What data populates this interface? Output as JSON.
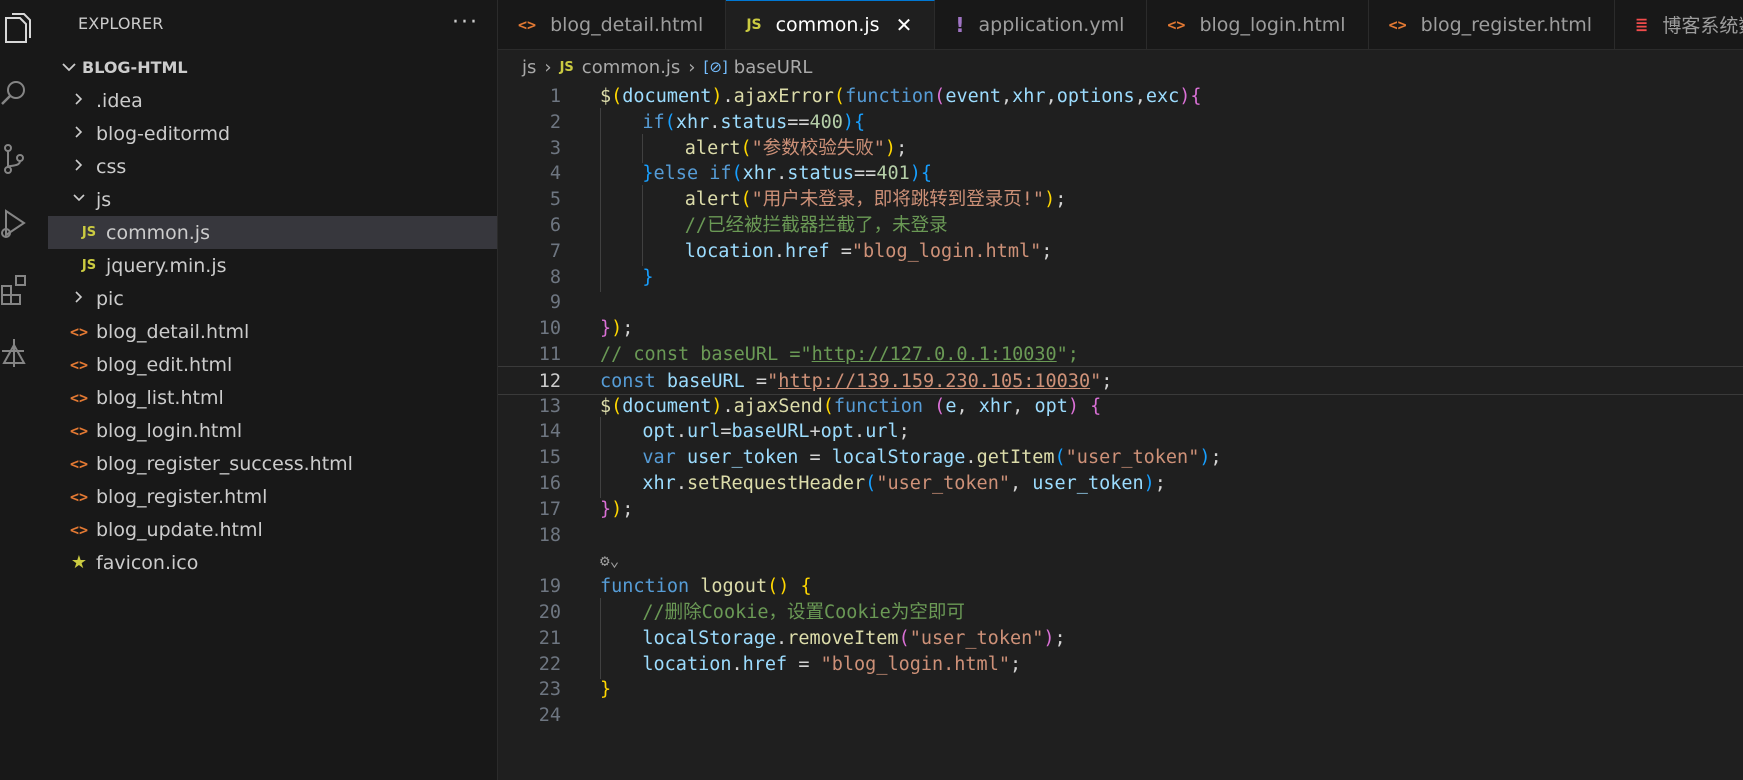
{
  "sidebar": {
    "title": "EXPLORER",
    "more": "···",
    "root": "BLOG-HTML",
    "items": [
      {
        "label": ".idea",
        "kind": "folder",
        "state": "collapsed",
        "indent": 1
      },
      {
        "label": "blog-editormd",
        "kind": "folder",
        "state": "collapsed",
        "indent": 1
      },
      {
        "label": "css",
        "kind": "folder",
        "state": "collapsed",
        "indent": 1
      },
      {
        "label": "js",
        "kind": "folder",
        "state": "expanded",
        "indent": 1
      },
      {
        "label": "common.js",
        "kind": "js",
        "indent": 2,
        "selected": true
      },
      {
        "label": "jquery.min.js",
        "kind": "js",
        "indent": 2
      },
      {
        "label": "pic",
        "kind": "folder",
        "state": "collapsed",
        "indent": 1
      },
      {
        "label": "blog_detail.html",
        "kind": "html",
        "indent": 1
      },
      {
        "label": "blog_edit.html",
        "kind": "html",
        "indent": 1
      },
      {
        "label": "blog_list.html",
        "kind": "html",
        "indent": 1
      },
      {
        "label": "blog_login.html",
        "kind": "html",
        "indent": 1
      },
      {
        "label": "blog_register_success.html",
        "kind": "html",
        "indent": 1
      },
      {
        "label": "blog_register.html",
        "kind": "html",
        "indent": 1
      },
      {
        "label": "blog_update.html",
        "kind": "html",
        "indent": 1
      },
      {
        "label": "favicon.ico",
        "kind": "star",
        "indent": 1
      }
    ]
  },
  "tabs": [
    {
      "label": "blog_detail.html",
      "kind": "html"
    },
    {
      "label": "common.js",
      "kind": "js",
      "active": true,
      "close": "✕"
    },
    {
      "label": "application.yml",
      "kind": "yml"
    },
    {
      "label": "blog_login.html",
      "kind": "html"
    },
    {
      "label": "blog_register.html",
      "kind": "html"
    },
    {
      "label": "博客系统数",
      "kind": "db"
    }
  ],
  "breadcrumb": {
    "folder": "js",
    "file": "common.js",
    "symbol": "baseURL"
  },
  "editor": {
    "current_line": 12,
    "lines": [
      {
        "n": 1,
        "indent": 0,
        "t": [
          [
            "$",
            "f"
          ],
          [
            "(",
            "b1"
          ],
          [
            "document",
            "v"
          ],
          [
            ")",
            "b1"
          ],
          [
            ".",
            "p"
          ],
          [
            "ajaxError",
            "f"
          ],
          [
            "(",
            "b1"
          ],
          [
            "function",
            "k"
          ],
          [
            "(",
            "b2"
          ],
          [
            "event",
            "v"
          ],
          [
            ",",
            "p"
          ],
          [
            "xhr",
            "v"
          ],
          [
            ",",
            "p"
          ],
          [
            "options",
            "v"
          ],
          [
            ",",
            "p"
          ],
          [
            "exc",
            "v"
          ],
          [
            ")",
            "b2"
          ],
          [
            "{",
            "b2"
          ]
        ]
      },
      {
        "n": 2,
        "indent": 1,
        "t": [
          [
            "if",
            "k"
          ],
          [
            "(",
            "b3"
          ],
          [
            "xhr",
            "v"
          ],
          [
            ".",
            "p"
          ],
          [
            "status",
            "v"
          ],
          [
            "==",
            "p"
          ],
          [
            "400",
            "n"
          ],
          [
            ")",
            "b3"
          ],
          [
            "{",
            "b3"
          ]
        ]
      },
      {
        "n": 3,
        "indent": 2,
        "t": [
          [
            "alert",
            "f"
          ],
          [
            "(",
            "b1"
          ],
          [
            "\"参数校验失败\"",
            "s"
          ],
          [
            ")",
            "b1"
          ],
          [
            ";",
            "p"
          ]
        ]
      },
      {
        "n": 4,
        "indent": 1,
        "t": [
          [
            "}",
            "b3"
          ],
          [
            "else ",
            "k"
          ],
          [
            "if",
            "k"
          ],
          [
            "(",
            "b3"
          ],
          [
            "xhr",
            "v"
          ],
          [
            ".",
            "p"
          ],
          [
            "status",
            "v"
          ],
          [
            "==",
            "p"
          ],
          [
            "401",
            "n"
          ],
          [
            ")",
            "b3"
          ],
          [
            "{",
            "b3"
          ]
        ]
      },
      {
        "n": 5,
        "indent": 2,
        "t": [
          [
            "alert",
            "f"
          ],
          [
            "(",
            "b1"
          ],
          [
            "\"用户未登录，即将跳转到登录页!\"",
            "s"
          ],
          [
            ")",
            "b1"
          ],
          [
            ";",
            "p"
          ]
        ]
      },
      {
        "n": 6,
        "indent": 2,
        "t": [
          [
            "//已经被拦截器拦截了，未登录",
            "c"
          ]
        ]
      },
      {
        "n": 7,
        "indent": 2,
        "t": [
          [
            "location",
            "v"
          ],
          [
            ".",
            "p"
          ],
          [
            "href",
            "v"
          ],
          [
            " =",
            "p"
          ],
          [
            "\"blog_login.html\"",
            "s"
          ],
          [
            ";",
            "p"
          ]
        ]
      },
      {
        "n": 8,
        "indent": 1,
        "t": [
          [
            "}",
            "b3"
          ]
        ]
      },
      {
        "n": 9,
        "indent": 0,
        "t": []
      },
      {
        "n": 10,
        "indent": 0,
        "t": [
          [
            "}",
            "b2"
          ],
          [
            ")",
            "b1"
          ],
          [
            ";",
            "p"
          ]
        ]
      },
      {
        "n": 11,
        "indent": 0,
        "t": [
          [
            "// const baseURL =\"",
            "c"
          ],
          [
            "http://127.0.0.1:10030",
            "cu"
          ],
          [
            "\";",
            "c"
          ]
        ]
      },
      {
        "n": 12,
        "indent": 0,
        "t": [
          [
            "const ",
            "k"
          ],
          [
            "baseURL",
            "v"
          ],
          [
            " =",
            "p"
          ],
          [
            "\"",
            "s"
          ],
          [
            "http://139.159.230.105:10030",
            "su"
          ],
          [
            "\"",
            "s"
          ],
          [
            ";",
            "p"
          ]
        ]
      },
      {
        "n": 13,
        "indent": 0,
        "t": [
          [
            "$",
            "f"
          ],
          [
            "(",
            "b1"
          ],
          [
            "document",
            "v"
          ],
          [
            ")",
            "b1"
          ],
          [
            ".",
            "p"
          ],
          [
            "ajaxSend",
            "f"
          ],
          [
            "(",
            "b1"
          ],
          [
            "function ",
            "k"
          ],
          [
            "(",
            "b2"
          ],
          [
            "e",
            "v"
          ],
          [
            ", ",
            "p"
          ],
          [
            "xhr",
            "v"
          ],
          [
            ", ",
            "p"
          ],
          [
            "opt",
            "v"
          ],
          [
            ")",
            "b2"
          ],
          [
            " ",
            "p"
          ],
          [
            "{",
            "b2"
          ]
        ]
      },
      {
        "n": 14,
        "indent": 1,
        "t": [
          [
            "opt",
            "v"
          ],
          [
            ".",
            "p"
          ],
          [
            "url",
            "v"
          ],
          [
            "=",
            "p"
          ],
          [
            "baseURL",
            "v"
          ],
          [
            "+",
            "p"
          ],
          [
            "opt",
            "v"
          ],
          [
            ".",
            "p"
          ],
          [
            "url",
            "v"
          ],
          [
            ";",
            "p"
          ]
        ]
      },
      {
        "n": 15,
        "indent": 1,
        "t": [
          [
            "var ",
            "k"
          ],
          [
            "user_token",
            "v"
          ],
          [
            " = ",
            "p"
          ],
          [
            "localStorage",
            "v"
          ],
          [
            ".",
            "p"
          ],
          [
            "getItem",
            "f"
          ],
          [
            "(",
            "b3"
          ],
          [
            "\"user_token\"",
            "s"
          ],
          [
            ")",
            "b3"
          ],
          [
            ";",
            "p"
          ]
        ]
      },
      {
        "n": 16,
        "indent": 1,
        "t": [
          [
            "xhr",
            "v"
          ],
          [
            ".",
            "p"
          ],
          [
            "setRequestHeader",
            "f"
          ],
          [
            "(",
            "b3"
          ],
          [
            "\"user_token\"",
            "s"
          ],
          [
            ", ",
            "p"
          ],
          [
            "user_token",
            "v"
          ],
          [
            ")",
            "b3"
          ],
          [
            ";",
            "p"
          ]
        ]
      },
      {
        "n": 17,
        "indent": 0,
        "t": [
          [
            "}",
            "b2"
          ],
          [
            ")",
            "b1"
          ],
          [
            ";",
            "p"
          ]
        ]
      },
      {
        "n": 18,
        "indent": 0,
        "t": []
      },
      {
        "n": "",
        "indent": 0,
        "hint": "⚙⌄",
        "t": []
      },
      {
        "n": 19,
        "indent": 0,
        "t": [
          [
            "function ",
            "k"
          ],
          [
            "logout",
            "f"
          ],
          [
            "(",
            "b1"
          ],
          [
            ")",
            "b1"
          ],
          [
            " ",
            "p"
          ],
          [
            "{",
            "b1"
          ]
        ]
      },
      {
        "n": 20,
        "indent": 1,
        "t": [
          [
            "//删除Cookie，设置Cookie为空即可",
            "c"
          ]
        ]
      },
      {
        "n": 21,
        "indent": 1,
        "t": [
          [
            "localStorage",
            "v"
          ],
          [
            ".",
            "p"
          ],
          [
            "removeItem",
            "f"
          ],
          [
            "(",
            "b2"
          ],
          [
            "\"user_token\"",
            "s"
          ],
          [
            ")",
            "b2"
          ],
          [
            ";",
            "p"
          ]
        ]
      },
      {
        "n": 22,
        "indent": 1,
        "t": [
          [
            "location",
            "v"
          ],
          [
            ".",
            "p"
          ],
          [
            "href",
            "v"
          ],
          [
            " = ",
            "p"
          ],
          [
            "\"blog_login.html\"",
            "s"
          ],
          [
            ";",
            "p"
          ]
        ]
      },
      {
        "n": 23,
        "indent": 0,
        "t": [
          [
            "}",
            "b1"
          ]
        ]
      },
      {
        "n": 24,
        "indent": 0,
        "t": []
      }
    ]
  }
}
